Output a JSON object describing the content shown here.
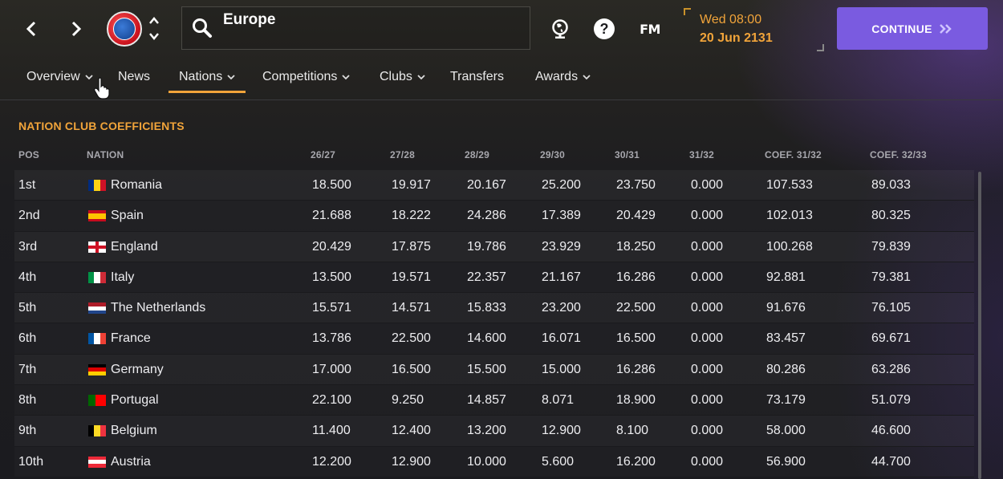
{
  "search": {
    "value": "Europe"
  },
  "date": {
    "line1": "Wed 08:00",
    "line2": "20 Jun 2131"
  },
  "continue_label": "CONTINUE",
  "fm_logo": "FM",
  "tabs": [
    {
      "label": "Overview",
      "dropdown": true
    },
    {
      "label": "News",
      "dropdown": false
    },
    {
      "label": "Nations",
      "dropdown": true,
      "active": true
    },
    {
      "label": "Competitions",
      "dropdown": true
    },
    {
      "label": "Clubs",
      "dropdown": true
    },
    {
      "label": "Transfers",
      "dropdown": false
    },
    {
      "label": "Awards",
      "dropdown": true
    }
  ],
  "section_title": "NATION CLUB COEFFICIENTS",
  "columns": [
    "POS",
    "NATION",
    "26/27",
    "27/28",
    "28/29",
    "29/30",
    "30/31",
    "31/32",
    "COEF. 31/32",
    "COEF. 32/33"
  ],
  "rows": [
    {
      "pos": "1st",
      "nation": "Romania",
      "flag": "romania",
      "values": [
        "18.500",
        "19.917",
        "20.167",
        "25.200",
        "23.750",
        "0.000",
        "107.533",
        "89.033"
      ]
    },
    {
      "pos": "2nd",
      "nation": "Spain",
      "flag": "spain",
      "values": [
        "21.688",
        "18.222",
        "24.286",
        "17.389",
        "20.429",
        "0.000",
        "102.013",
        "80.325"
      ]
    },
    {
      "pos": "3rd",
      "nation": "England",
      "flag": "england",
      "values": [
        "20.429",
        "17.875",
        "19.786",
        "23.929",
        "18.250",
        "0.000",
        "100.268",
        "79.839"
      ]
    },
    {
      "pos": "4th",
      "nation": "Italy",
      "flag": "italy",
      "values": [
        "13.500",
        "19.571",
        "22.357",
        "21.167",
        "16.286",
        "0.000",
        "92.881",
        "79.381"
      ]
    },
    {
      "pos": "5th",
      "nation": "The Netherlands",
      "flag": "netherlands",
      "values": [
        "15.571",
        "14.571",
        "15.833",
        "23.200",
        "22.500",
        "0.000",
        "91.676",
        "76.105"
      ]
    },
    {
      "pos": "6th",
      "nation": "France",
      "flag": "france",
      "values": [
        "13.786",
        "22.500",
        "14.600",
        "16.071",
        "16.500",
        "0.000",
        "83.457",
        "69.671"
      ]
    },
    {
      "pos": "7th",
      "nation": "Germany",
      "flag": "germany",
      "values": [
        "17.000",
        "16.500",
        "15.500",
        "15.000",
        "16.286",
        "0.000",
        "80.286",
        "63.286"
      ]
    },
    {
      "pos": "8th",
      "nation": "Portugal",
      "flag": "portugal",
      "values": [
        "22.100",
        "9.250",
        "14.857",
        "8.071",
        "18.900",
        "0.000",
        "73.179",
        "51.079"
      ]
    },
    {
      "pos": "9th",
      "nation": "Belgium",
      "flag": "belgium",
      "values": [
        "11.400",
        "12.400",
        "13.200",
        "12.900",
        "8.100",
        "0.000",
        "58.000",
        "46.600"
      ]
    },
    {
      "pos": "10th",
      "nation": "Austria",
      "flag": "austria",
      "values": [
        "12.200",
        "12.900",
        "10.000",
        "5.600",
        "16.200",
        "0.000",
        "56.900",
        "44.700"
      ]
    }
  ],
  "colors": {
    "accent": "#f1a43a",
    "continue": "#7a5be0"
  },
  "icons": [
    "back-arrow-icon",
    "forward-arrow-icon",
    "uefa-logo",
    "up-down-icon",
    "search-icon",
    "globe-icon",
    "help-icon",
    "fm-logo",
    "continue-chevrons-icon",
    "chevron-down-icon",
    "hand-cursor-icon"
  ]
}
